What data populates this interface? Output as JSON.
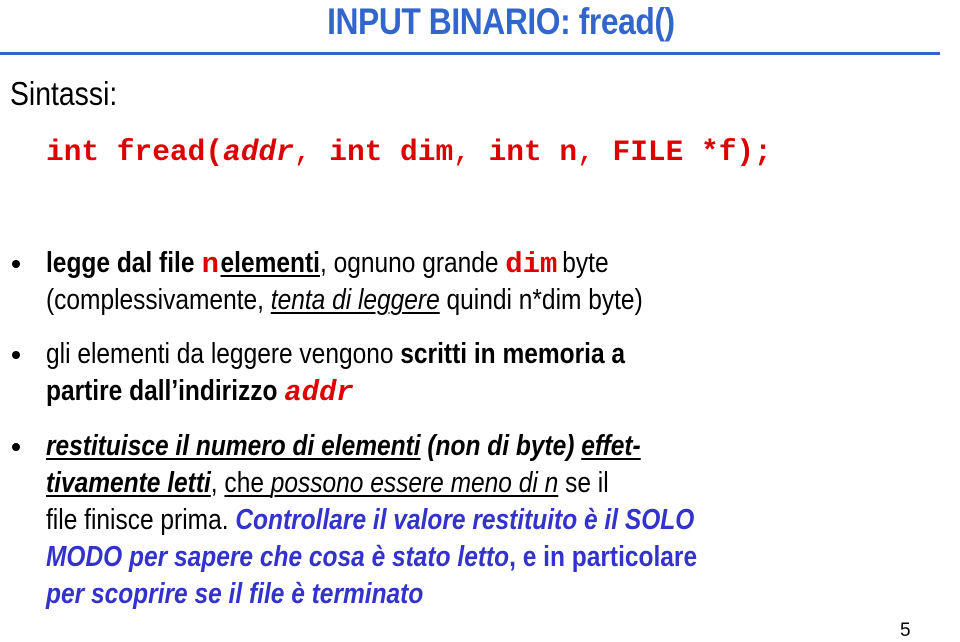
{
  "slide": {
    "title": "INPUT BINARIO: fread()",
    "page_number": "5",
    "colors": {
      "title": "#3366CC",
      "code": "#DD0000",
      "callout": "#3333CC",
      "text": "#000000"
    }
  },
  "syntax": {
    "label": "Sintassi:",
    "signature": {
      "p1": "int fread(",
      "p2": "addr",
      "p3": ",",
      "p4": " int dim",
      "p5": ",",
      "p6": " int n",
      "p7": ",",
      "p8": " FILE *f);"
    }
  },
  "bullets": [
    {
      "icon": "bullet-dot",
      "line1": {
        "t1": "legge dal file ",
        "code1": "n",
        "t2": "elementi",
        "t3": ", ognuno grande ",
        "code2": "dim",
        "t4": "byte"
      },
      "line2": {
        "t1": "(complessivamente, ",
        "t2": "tenta di leggere",
        "t3": " quindi n*dim byte)"
      }
    },
    {
      "icon": "bullet-dot",
      "line1": {
        "t1": "gli elementi da leggere vengono ",
        "t2": "scritti in memoria a"
      },
      "line2": {
        "t1": "partire dall’indirizzo ",
        "code1": "addr"
      }
    },
    {
      "icon": "bullet-dot",
      "line1": {
        "t1": "restituisce il numero di elementi",
        "t2": " (non di byte) ",
        "t3": "effet-"
      },
      "line2": {
        "t1": "tivamente letti",
        "t2": ", ",
        "t3": "che ",
        "t4": "possono essere meno di n",
        "t5": " se il"
      },
      "line3": {
        "t1": "file finisce prima. ",
        "t2": "Controllare il valore restituito è il SOLO"
      },
      "line4": {
        "t1": "MODO per sapere che cosa è stato letto",
        "t2": ", e in particolare"
      },
      "line5": {
        "t1": "per scoprire se il file è terminato"
      }
    }
  ]
}
